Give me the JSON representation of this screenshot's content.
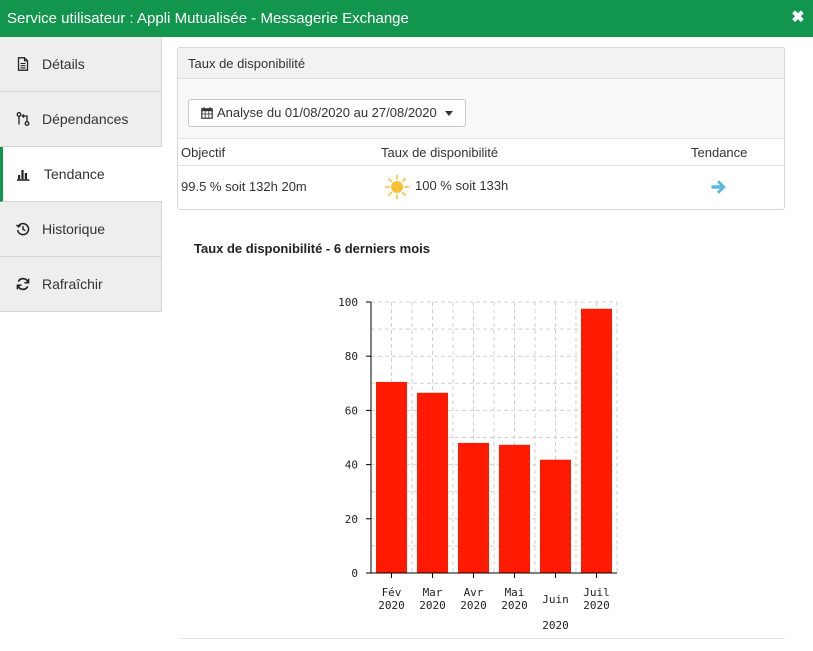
{
  "window": {
    "title": "Service utilisateur : Appli Mutualisée - Messagerie Exchange",
    "close_icon": "✖"
  },
  "sidebar": {
    "items": [
      {
        "label": "Détails",
        "icon": "document-icon"
      },
      {
        "label": "Dépendances",
        "icon": "dependencies-icon"
      },
      {
        "label": "Tendance",
        "icon": "bar-chart-icon",
        "active": true
      },
      {
        "label": "Historique",
        "icon": "history-icon"
      },
      {
        "label": "Rafraîchir",
        "icon": "refresh-icon"
      }
    ]
  },
  "panel": {
    "title": "Taux de disponibilité",
    "analyse_label": "Analyse du 01/08/2020 au 27/08/2020",
    "table": {
      "headers": [
        "Objectif",
        "Taux de disponibilité",
        "Tendance"
      ],
      "objectif": "99.5 % soit 132h 20m",
      "taux": "100 % soit 133h",
      "tendance_icon": "arrow-right-icon"
    }
  },
  "colors": {
    "header_green": "#12964d",
    "bar_red": "#ff1a00",
    "sun_yellow": "#f7c035",
    "arrow_blue": "#5bb8de"
  },
  "chart_data": {
    "type": "bar",
    "title": "Taux de disponibilité - 6 derniers mois",
    "categories": [
      "Fév 2020",
      "Mar 2020",
      "Avr 2020",
      "Mai 2020",
      "Juin 2020",
      "Juil 2020"
    ],
    "category_lines": [
      [
        "Fév",
        "2020"
      ],
      [
        "Mar",
        "2020"
      ],
      [
        "Avr",
        "2020"
      ],
      [
        "Mai",
        "2020"
      ],
      [
        "Juin",
        "2020"
      ],
      [
        "Juil",
        "2020"
      ]
    ],
    "values": [
      70.5,
      66.5,
      48,
      47.3,
      41.8,
      97.5
    ],
    "ylim": [
      0,
      100
    ],
    "yticks": [
      "0",
      "20",
      "40",
      "60",
      "80",
      "100"
    ],
    "grid": true,
    "xlabel": "",
    "ylabel": ""
  }
}
